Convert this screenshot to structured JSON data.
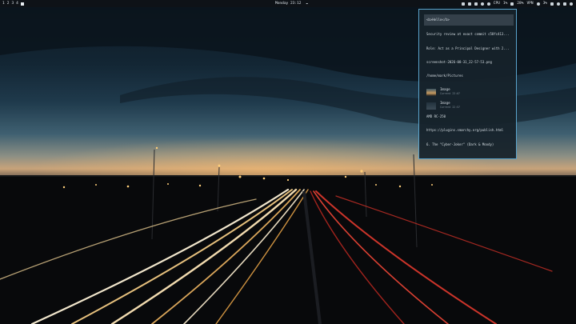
{
  "topbar": {
    "workspaces": [
      "1",
      "2",
      "3",
      "4"
    ],
    "clock": "Monday 23:12",
    "tray": {
      "cpu": "CPU",
      "cpu_value": "1%",
      "ram_value": "28%",
      "vpn": "VPN",
      "battery": "3%"
    }
  },
  "clipboard": {
    "items": [
      {
        "text": "<b>Hello</b>"
      },
      {
        "text": "Security review at exact commit c58fc413..."
      },
      {
        "text": "Role: Act as a Principal Designer with 2..."
      },
      {
        "text": "screenshot-2026-08-31_22-57-53.png"
      },
      {
        "text": "/home/mark/Pictures"
      },
      {
        "title": "Image",
        "sub": "Current 23:07"
      },
      {
        "title": "Image",
        "sub": "Current 22:57"
      },
      {
        "text": "AMD RC-250"
      },
      {
        "text": "https://plugins.smarchy.org/publish.html"
      },
      {
        "text": "6. The \"Cyber-Joker\" (Dark & Moody)"
      }
    ]
  },
  "colors": {
    "panel_border": "#5aa3cc",
    "panel_bg": "#16222a",
    "topbar_bg": "#0e1217"
  }
}
